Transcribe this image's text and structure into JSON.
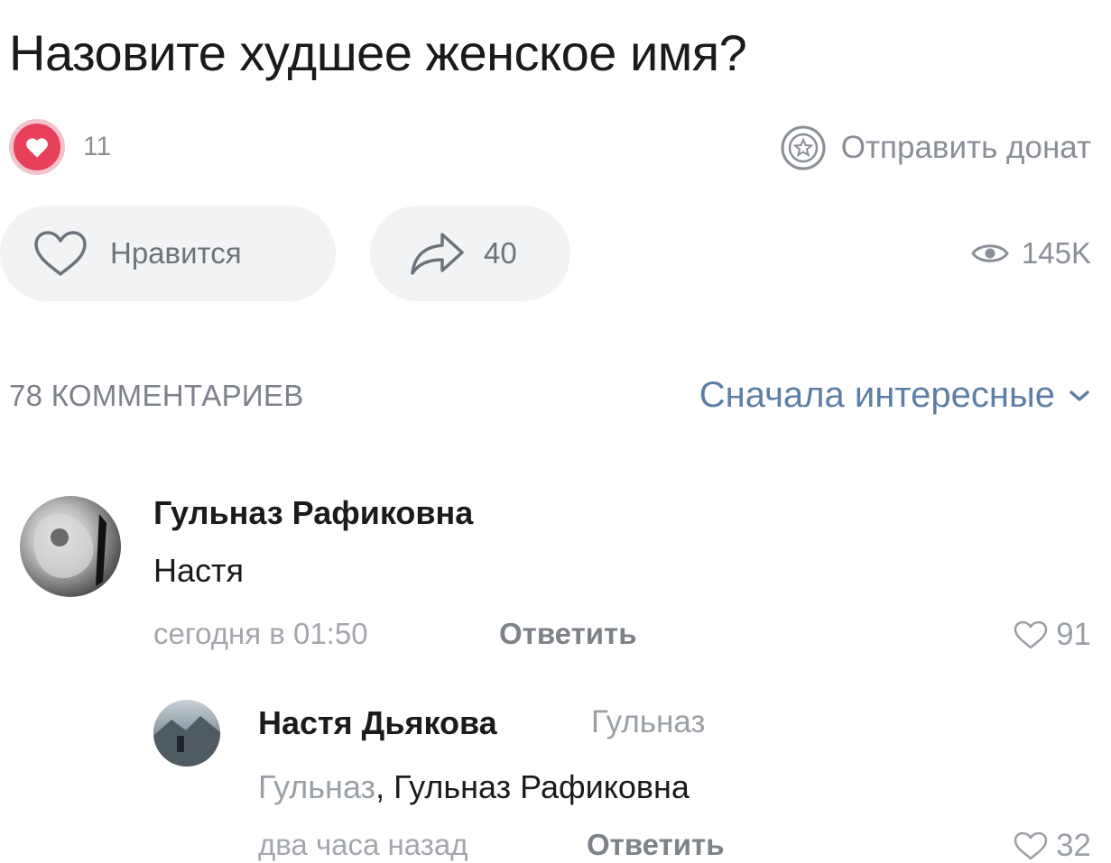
{
  "post": {
    "title": "Назовите худшее женское имя?",
    "reaction_count": "11",
    "donate_label": "Отправить донат",
    "like_label": "Нравится",
    "share_count": "40",
    "views": "145K"
  },
  "comments_header": {
    "count_label": "78 КОММЕНТАРИЕВ",
    "sort_label": "Сначала интересные"
  },
  "comments": [
    {
      "author": "Гульназ Рафиковна",
      "text": "Настя",
      "time": "сегодня в 01:50",
      "reply_label": "Ответить",
      "likes": "91"
    },
    {
      "author": "Настя Дьякова",
      "reply_to": "Гульназ",
      "mention": "Гульназ",
      "text_rest": ", Гульназ Рафиковна",
      "time": "два часа назад",
      "reply_label": "Ответить",
      "likes": "32"
    }
  ],
  "colors": {
    "accent_link": "#5d7fa6",
    "reaction_heart": "#e8405a",
    "muted_text": "#8a8f97",
    "pill_background": "#f2f3f5"
  },
  "icons": [
    "heart-filled-icon",
    "donate-star-icon",
    "heart-outline-icon",
    "share-arrow-icon",
    "eye-icon",
    "chevron-down-icon"
  ]
}
